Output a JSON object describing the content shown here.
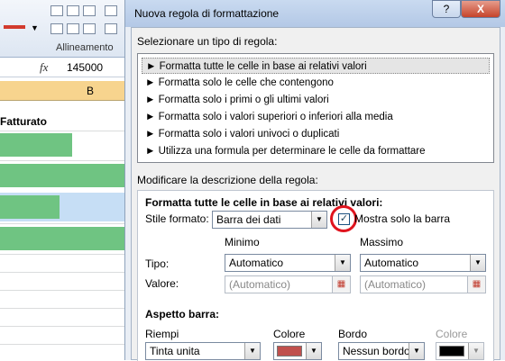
{
  "excel": {
    "ribbon_label": "Allineamento",
    "formula_value": "145000",
    "fx_label": "fx",
    "column_header": "B",
    "cell_header": "Fatturato",
    "bar_color": "#6fc482",
    "selection_color": "#c6def5"
  },
  "dialog": {
    "title": "Nuova regola di formattazione",
    "help_label": "?",
    "close_label": "X",
    "rule_type_heading": "Selezionare un tipo di regola:",
    "rule_types": [
      "► Formatta tutte le celle in base ai relativi valori",
      "► Formatta solo le celle che contengono",
      "► Formatta solo i primi o gli ultimi valori",
      "► Formatta solo i valori superiori o inferiori alla media",
      "► Formatta solo i valori univoci o duplicati",
      "► Utilizza una formula per determinare le celle da formattare"
    ],
    "selected_rule_index": 0,
    "description_heading": "Modificare la descrizione della regola:",
    "format_all_heading": "Formatta tutte le celle in base ai relativi valori:",
    "style_label": "Stile formato:",
    "style_value": "Barra dei dati",
    "show_bar_only_label": "Mostra solo la barra",
    "show_bar_only_checked": true,
    "min_label": "Minimo",
    "max_label": "Massimo",
    "type_label": "Tipo:",
    "min_type": "Automatico",
    "max_type": "Automatico",
    "value_label": "Valore:",
    "min_value_placeholder": "(Automatico)",
    "max_value_placeholder": "(Automatico)",
    "bar_appearance_heading": "Aspetto barra:",
    "fill_label": "Riempi",
    "fill_value": "Tinta unita",
    "color_label": "Colore",
    "fill_color": "#c0504d",
    "border_label": "Bordo",
    "border_value": "Nessun bordo",
    "border_color_label": "Colore",
    "border_color": "#000000"
  }
}
